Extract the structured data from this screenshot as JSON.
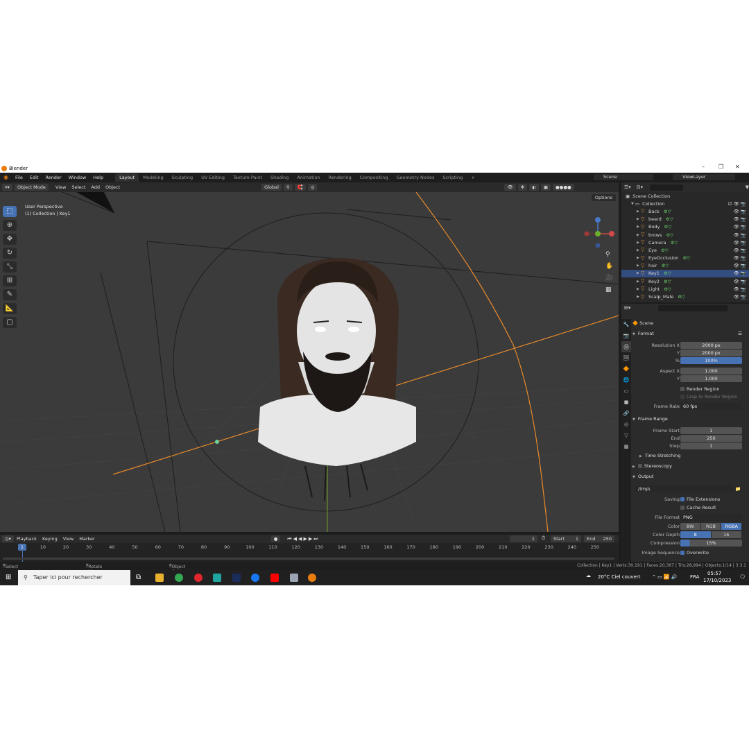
{
  "window": {
    "title": "Blender"
  },
  "menu": [
    "File",
    "Edit",
    "Render",
    "Window",
    "Help"
  ],
  "workspaces": [
    "Layout",
    "Modeling",
    "Sculpting",
    "UV Editing",
    "Texture Paint",
    "Shading",
    "Animation",
    "Rendering",
    "Compositing",
    "Geometry Nodes",
    "Scripting",
    "+"
  ],
  "scene_name": "Scene",
  "view_layer": "ViewLayer",
  "viewport": {
    "mode": "Object Mode",
    "menus": [
      "View",
      "Select",
      "Add",
      "Object"
    ],
    "transform_orientation": "Global",
    "options": "Options",
    "info_line1": "User Perspective",
    "info_line2": "(1) Collection | Key1"
  },
  "outliner": {
    "root": "Scene Collection",
    "collection": "Collection",
    "items": [
      {
        "name": "Back"
      },
      {
        "name": "beard"
      },
      {
        "name": "Body"
      },
      {
        "name": "brows"
      },
      {
        "name": "Camera"
      },
      {
        "name": "Eye"
      },
      {
        "name": "EyeOcclusion"
      },
      {
        "name": "hair"
      },
      {
        "name": "Key1",
        "selected": true
      },
      {
        "name": "Key2"
      },
      {
        "name": "Light"
      },
      {
        "name": "Scalp_Male"
      }
    ]
  },
  "properties": {
    "context": "Scene",
    "format": {
      "section": "Format",
      "res_x_label": "Resolution X",
      "res_x": "2000 px",
      "res_y_label": "Y",
      "res_y": "2000 px",
      "pct_label": "%",
      "pct": "100%",
      "aspect_x_label": "Aspect X",
      "aspect_x": "1.000",
      "aspect_y_label": "Y",
      "aspect_y": "1.000",
      "render_region": "Render Region",
      "crop_region": "Crop to Render Region",
      "frame_rate_label": "Frame Rate",
      "frame_rate": "60 fps"
    },
    "frame_range": {
      "section": "Frame Range",
      "start_label": "Frame Start",
      "start": "1",
      "end_label": "End",
      "end": "250",
      "step_label": "Step",
      "step": "1",
      "time_stretching": "Time Stretching"
    },
    "stereoscopy": "Stereoscopy",
    "output": {
      "section": "Output",
      "path": "/tmp\\",
      "saving_label": "Saving",
      "file_extensions": "File Extensions",
      "cache_result": "Cache Result",
      "file_format_label": "File Format",
      "file_format": "PNG",
      "color_label": "Color",
      "color_opts": [
        "BW",
        "RGB",
        "RGBA"
      ],
      "color_selected": "RGBA",
      "depth_label": "Color Depth",
      "depth_opts": [
        "8",
        "16"
      ],
      "depth_selected": "8",
      "compression_label": "Compression",
      "compression": "15%",
      "compression_value": 0.15,
      "image_seq_label": "Image Sequence",
      "overwrite": "Overwrite"
    }
  },
  "timeline": {
    "menus": [
      "Playback",
      "Keying",
      "View",
      "Marker"
    ],
    "current_frame": "1",
    "start_label": "Start",
    "start": "1",
    "end_label": "End",
    "end": "250",
    "ticks": [
      "1",
      "10",
      "20",
      "30",
      "40",
      "50",
      "60",
      "70",
      "80",
      "90",
      "100",
      "110",
      "120",
      "130",
      "140",
      "150",
      "160",
      "170",
      "180",
      "190",
      "200",
      "210",
      "220",
      "230",
      "240",
      "250"
    ]
  },
  "statusbar": {
    "select": "Select",
    "rotate": "Rotate View",
    "context_menu": "Object Context Menu",
    "stats": "Collection | Key1 | Verts:30,191 | Faces:20,367 | Tris:28,994 | Objects:1/14 | 3.3.1"
  },
  "taskbar": {
    "search": "Taper ici pour rechercher",
    "weather": "20°C  Ciel couvert",
    "lang": "FRA",
    "time": "05:57",
    "date": "17/10/2023"
  }
}
